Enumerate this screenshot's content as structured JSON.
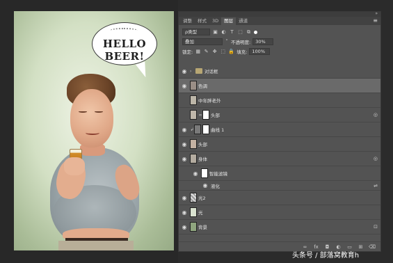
{
  "canvas": {
    "speech_bubble_text": "HELLO BEER!"
  },
  "panel": {
    "tabs": [
      {
        "label": "调整",
        "active": false
      },
      {
        "label": "样式",
        "active": false
      },
      {
        "label": "3D",
        "active": false
      },
      {
        "label": "图层",
        "active": true
      },
      {
        "label": "通道",
        "active": false
      }
    ],
    "filter_label": "ρ类型",
    "blend_mode": "叠加",
    "opacity_label": "不透明度:",
    "opacity_value": "30%",
    "lock_label": "锁定:",
    "fill_label": "填充:",
    "fill_value": "100%"
  },
  "layers": [
    {
      "name": "对话框",
      "type": "group",
      "visible": true,
      "selected": false
    },
    {
      "name": "色调",
      "type": "layer",
      "visible": true,
      "selected": true
    },
    {
      "name": "中年胖老外",
      "type": "layer",
      "visible": false,
      "selected": false
    },
    {
      "name": "头部",
      "type": "masked",
      "visible": false,
      "selected": false,
      "badge": "◎"
    },
    {
      "name": "曲线 1",
      "type": "adjustment",
      "visible": true,
      "selected": false
    },
    {
      "name": "头部",
      "type": "layer",
      "visible": true,
      "selected": false
    },
    {
      "name": "身体",
      "type": "smart",
      "visible": true,
      "selected": false,
      "badge": "◎"
    },
    {
      "name": "智能滤镜",
      "type": "smart-filter",
      "visible": true,
      "selected": false
    },
    {
      "name": "液化",
      "type": "filter",
      "visible": true,
      "selected": false,
      "badge": "⇌"
    },
    {
      "name": "光2",
      "type": "layer",
      "visible": true,
      "selected": false
    },
    {
      "name": "光",
      "type": "layer",
      "visible": true,
      "selected": false
    },
    {
      "name": "背景",
      "type": "background",
      "visible": true,
      "selected": false,
      "badge": "🔒"
    }
  ],
  "watermark": "头条号 / 部落窝教育h"
}
